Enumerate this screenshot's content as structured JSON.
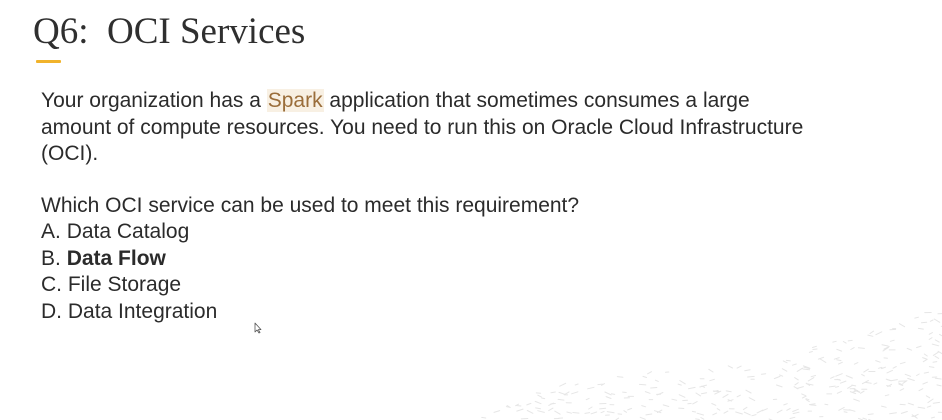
{
  "slide": {
    "title": "Q6:  OCI Services",
    "question": {
      "line1_pre": "Your organization has a ",
      "highlight": "Spark",
      "line1_post": " application that sometimes consumes a large",
      "line2": "amount of compute resources. You need to run this on Oracle Cloud Infrastructure",
      "line3": "(OCI)."
    },
    "prompt": "Which OCI service can be used to meet this requirement?",
    "options": [
      {
        "prefix": "A. ",
        "label": "Data Catalog"
      },
      {
        "prefix": "B. ",
        "label": "Data Flow"
      },
      {
        "prefix": "C. ",
        "label": "File Storage"
      },
      {
        "prefix": "D. ",
        "label": "Data Integration"
      }
    ],
    "accent_color": "#f1b32b",
    "highlight_color": "#f8f0e3"
  }
}
